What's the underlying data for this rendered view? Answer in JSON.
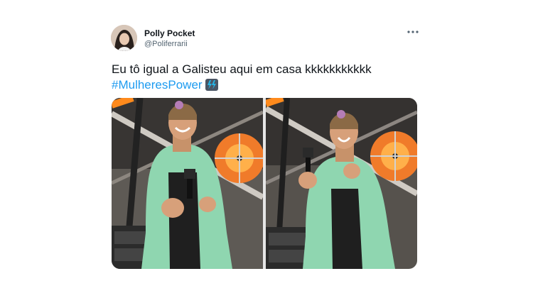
{
  "user": {
    "display_name": "Polly Pocket",
    "handle": "@Poliferrarii",
    "avatar_icon": "profile-photo"
  },
  "tweet": {
    "text": "Eu tô igual a Galisteu aqui em casa kkkkkkkkkkk",
    "hashtag": "#MulheresPower",
    "emoji_icon": "high-voltage-icon"
  },
  "menu": {
    "icon": "more-options-icon"
  },
  "media": {
    "count": 2,
    "panels": [
      "left-photo",
      "right-photo"
    ]
  },
  "colors": {
    "hashtag": "#1d9bf0",
    "text": "#0f1419",
    "muted": "#536471",
    "jacket": "#8fd6b0"
  }
}
